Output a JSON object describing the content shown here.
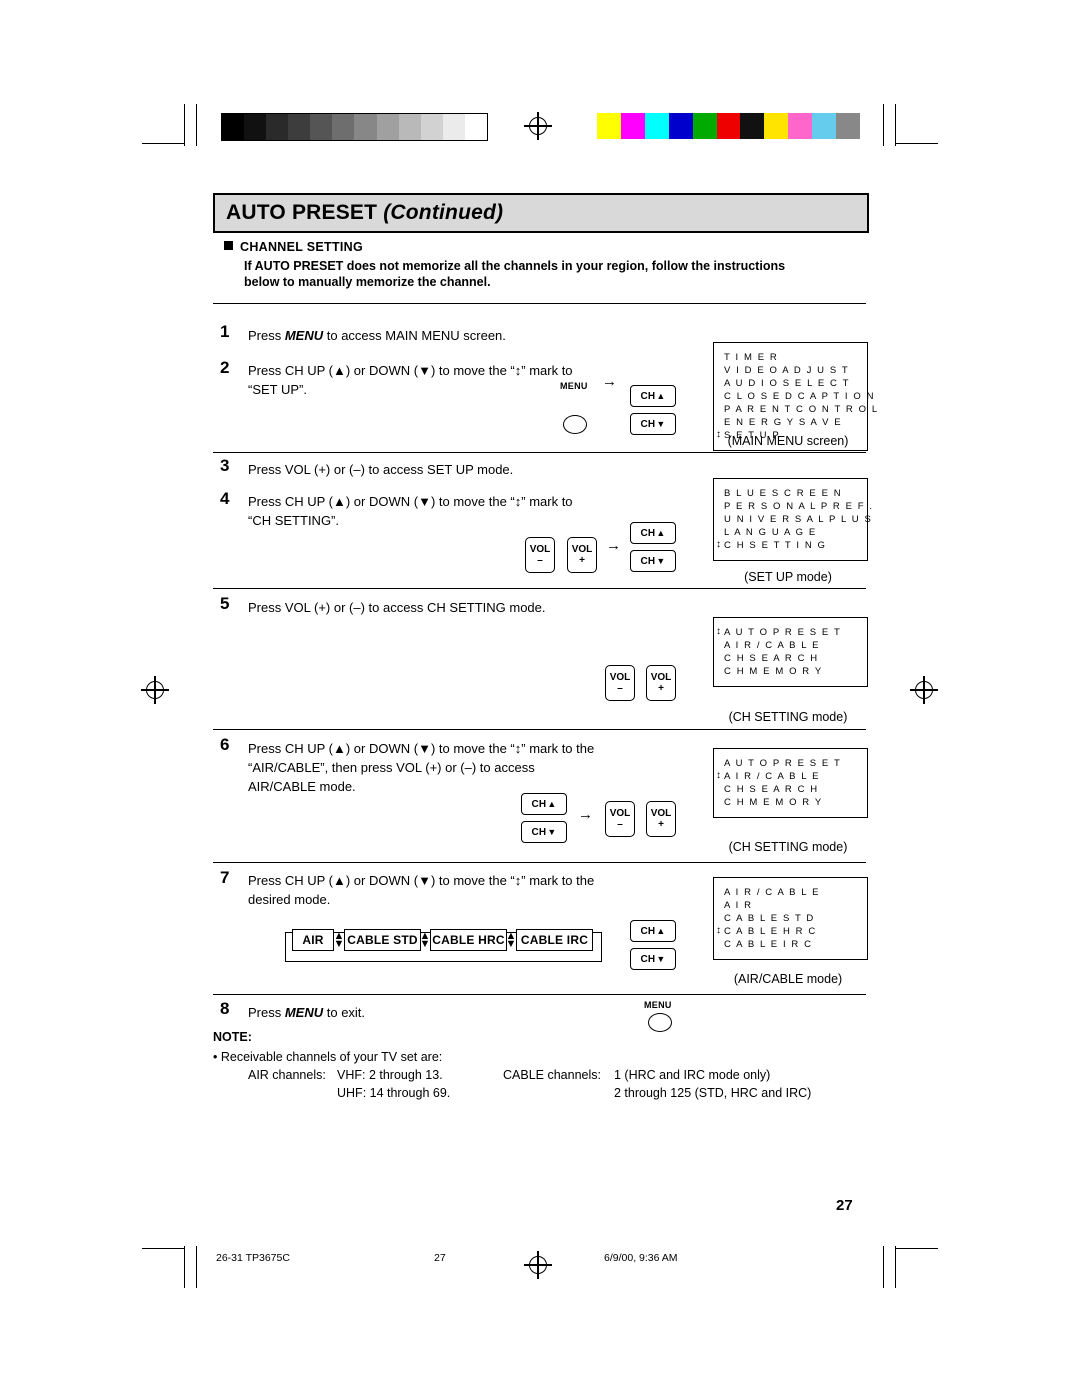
{
  "header": {
    "title_main": "AUTO PRESET",
    "title_italic": "(Continued)"
  },
  "section": {
    "heading": "CHANNEL SETTING",
    "body_line1": "If AUTO PRESET does not memorize all the channels in your region, follow the instructions",
    "body_line2": "below to manually memorize the channel."
  },
  "steps": [
    {
      "num": "1",
      "text": "Press MENU to access MAIN MENU screen.",
      "text_parts": [
        "Press ",
        "MENU",
        " to access MAIN MENU screen."
      ]
    },
    {
      "num": "2",
      "line1": "Press  CH UP (▲)  or  DOWN (▼)  to  move  the  “↕”  mark  to",
      "line2": "“SET UP”."
    },
    {
      "num": "3",
      "text": "Press VOL (+) or (–) to access SET UP mode."
    },
    {
      "num": "4",
      "line1": "Press  CH UP (▲)  or  DOWN (▼)  to  move  the  “↕”  mark  to",
      "line2": "“CH SETTING”."
    },
    {
      "num": "5",
      "text": "Press VOL (+) or (–) to access CH SETTING mode."
    },
    {
      "num": "6",
      "line1": "Press CH UP (▲) or DOWN (▼) to move the “↕” mark to the",
      "line2": "“AIR/CABLE”,  then  press  VOL (+)  or  (–)  to  access",
      "line3": "AIR/CABLE mode."
    },
    {
      "num": "7",
      "line1": "Press CH UP (▲) or DOWN (▼) to move the “↕” mark to the",
      "line2": "desired mode."
    },
    {
      "num": "8",
      "text": "Press MENU to exit."
    }
  ],
  "osd_screens": [
    {
      "caption": "(MAIN MENU screen)",
      "lines": [
        "T I M E R",
        "V I D E O   A D J U S T",
        "A U D I O   S E L E C T",
        "C L O S E D   C A P T I O N",
        "P A R E N T   C O N T R O L",
        "E N E R G Y   S A V E",
        "S E T   U P"
      ],
      "marked_index": 6
    },
    {
      "caption": "(SET UP mode)",
      "lines": [
        "B L U E   S C R E E N",
        "P E R S O N A L   P R E F .",
        "U N I V E R S A L   P L U S",
        "L A N G U A G E",
        "C H   S E T T I N G"
      ],
      "marked_index": 4
    },
    {
      "caption": "(CH SETTING mode)",
      "lines": [
        "A U T O   P R E S E T",
        "A I R / C A B L E",
        "C H   S E A R C H",
        "C H   M E M O R Y"
      ],
      "marked_index": 0
    },
    {
      "caption": "(CH SETTING mode)",
      "lines": [
        "A U T O   P R E S E T",
        "A I R / C A B L E",
        "C H   S E A R C H",
        "C H   M E M O R Y"
      ],
      "marked_index": 1
    },
    {
      "caption": "(AIR/CABLE mode)",
      "lines": [
        "A I R / C A B L E",
        "A I R",
        "C A B L E   S T D",
        "C A B L E   H R C",
        "C A B L E   I R C"
      ],
      "marked_index": 3
    }
  ],
  "buttons": {
    "menu": "MENU",
    "ch_up": "CH",
    "ch_down": "CH",
    "vol_minus_top": "VOL",
    "vol_minus_sign": "–",
    "vol_plus_top": "VOL",
    "vol_plus_sign": "+",
    "arrow": "→"
  },
  "chain": {
    "items": [
      "AIR",
      "CABLE STD",
      "CABLE HRC",
      "CABLE IRC"
    ]
  },
  "note": {
    "heading": "NOTE:",
    "bullet": "• Receivable channels of your TV set are:",
    "air_label": "AIR channels:",
    "air_vhf": "VHF: 2 through 13.",
    "air_uhf": "UHF: 14 through 69.",
    "cable_label": "CABLE channels:",
    "cable_line1": "1 (HRC and IRC mode only)",
    "cable_line2": "2 through 125 (STD, HRC and IRC)"
  },
  "page_number": "27",
  "footer": {
    "left": "26-31 TP3675C",
    "center": "27",
    "right": "6/9/00, 9:36 AM"
  },
  "colors": {
    "title_bg": "#d9d9d9",
    "ink": "#000000",
    "paper": "#ffffff"
  },
  "colorbar": [
    "#ffff00",
    "#ff00ff",
    "#00ffff",
    "#0000cc",
    "#00aa00",
    "#ee0000",
    "#111111",
    "#ffe400",
    "#ff66cc",
    "#66ccee",
    "#888888"
  ],
  "graybar": [
    "#000000",
    "#111111",
    "#2a2a2a",
    "#3d3d3d",
    "#555555",
    "#6e6e6e",
    "#878787",
    "#a0a0a0",
    "#b9b9b9",
    "#d2d2d2",
    "#ebebeb",
    "#ffffff"
  ]
}
